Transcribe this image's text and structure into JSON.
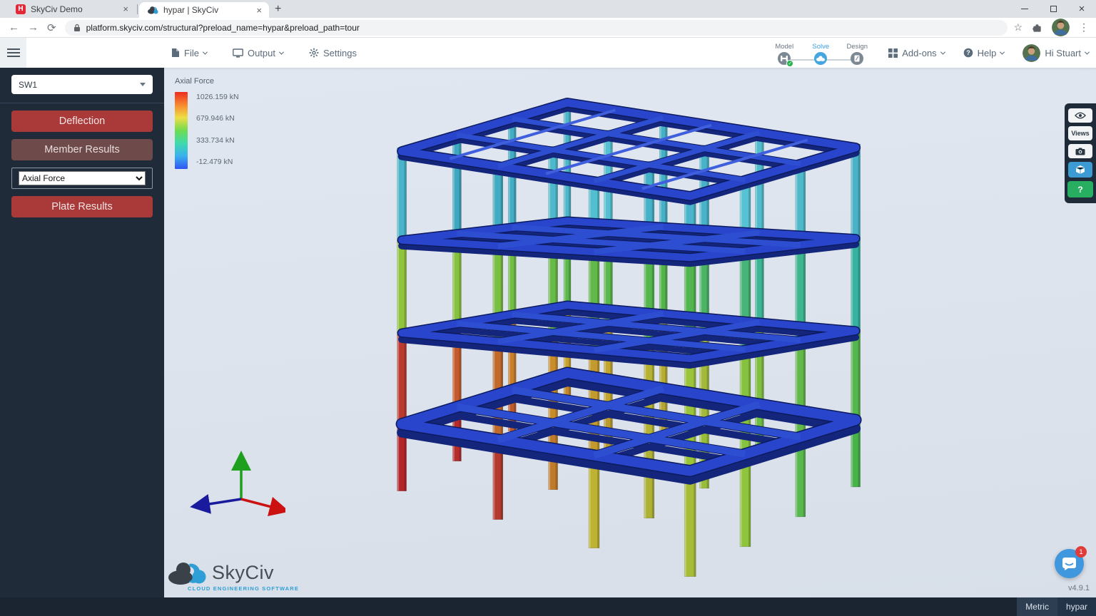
{
  "browser": {
    "tabs": [
      {
        "title": "SkyCiv Demo",
        "favicon": "H"
      },
      {
        "title": "hypar | SkyCiv"
      }
    ],
    "new_tab": "+",
    "url": "platform.skyciv.com/structural?preload_name=hypar&preload_path=tour",
    "window_controls": {
      "minimize": "–",
      "close": "×"
    },
    "nav": {
      "back": "←",
      "forward": "→",
      "refresh": "⟳",
      "bookmark": "☆",
      "menu": "⋮"
    }
  },
  "header": {
    "menu": [
      {
        "label": "File"
      },
      {
        "label": "Output"
      },
      {
        "label": "Settings"
      }
    ],
    "stepper": [
      {
        "label": "Model"
      },
      {
        "label": "Solve"
      },
      {
        "label": "Design"
      }
    ],
    "check": "✓",
    "addons_label": "Add-ons",
    "help_label": "Help",
    "user_label": "Hi Stuart"
  },
  "sidebar": {
    "case_select": "SW1",
    "deflection_label": "Deflection",
    "member_results_label": "Member Results",
    "result_select": "Axial Force",
    "plate_results_label": "Plate Results"
  },
  "legend": {
    "title": "Axial Force",
    "labels": [
      "1026.159 kN",
      "679.946 kN",
      "333.734 kN",
      "-12.479 kN"
    ],
    "gradient": [
      "#ee2b20",
      "#f6882e",
      "#eede45",
      "#6fdc4f",
      "#3fd9ae",
      "#3ab0ee",
      "#2e55f5"
    ]
  },
  "right_toolbar": {
    "views_label": "Views",
    "help_glyph": "?"
  },
  "viewport": {
    "version": "v4.9.1",
    "chat_badge": "1"
  },
  "logo": {
    "name": "SkyCiv",
    "tagline": "CLOUD ENGINEERING SOFTWARE"
  },
  "status_bar": {
    "unit_system": "Metric",
    "project_name": "hypar"
  },
  "model": {
    "beam": {
      "main": "#2945cb",
      "line": "#2e4ed2",
      "edge": "#0c1a5e",
      "extrude": "#14267c",
      "secondary": "#3f5fdc"
    },
    "story_colors": [
      [
        "#4fb6c9",
        "#45b0c6",
        "#52bccd",
        "#49b2c8",
        "#42adc4",
        "#55c0d1",
        "#47b3c9",
        "#4fb9cb",
        "#3da8c0",
        "#4fb9cc",
        "#45b1c7",
        "#57c2d3",
        "#49b4c9",
        "#41abc2",
        "#53becf",
        "#4ab5ca"
      ],
      [
        "#5cb84e",
        "#52b44a",
        "#3eb594",
        "#35b2a0",
        "#74bd45",
        "#5bb84c",
        "#4bb465",
        "#3db58e",
        "#86c23f",
        "#68ba48",
        "#55b64f",
        "#49b478",
        "#8fc43c",
        "#79bf43",
        "#62b94a",
        "#52b650"
      ],
      [
        "#c8a32c",
        "#b7ae33",
        "#7fbf41",
        "#55b64e",
        "#c97f2a",
        "#c2a52e",
        "#a3b93a",
        "#62b94a",
        "#c55b2c",
        "#c88c2b",
        "#b5b234",
        "#86c23f",
        "#bb3a30",
        "#c06a2c",
        "#c29a2e",
        "#9bc43b"
      ],
      [
        "#c2882a",
        "#b4a534",
        "#6cbc45",
        "#48b34b",
        "#c05a2b",
        "#bb9c30",
        "#98bd3a",
        "#58b74d",
        "#b52d2b",
        "#c07b2a",
        "#adb136",
        "#8fc43c",
        "#b2262a",
        "#b33a2c",
        "#bdb231",
        "#a8bd37"
      ]
    ]
  }
}
